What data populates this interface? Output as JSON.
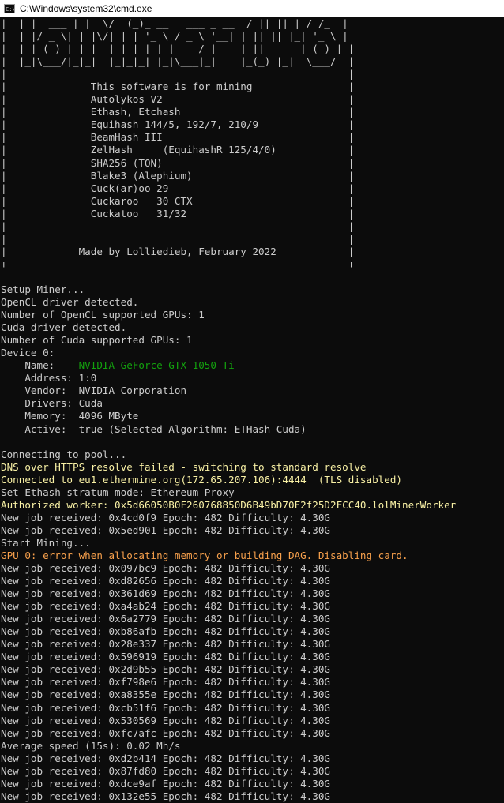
{
  "window": {
    "title": "C:\\Windows\\system32\\cmd.exe",
    "icon": "cmd-icon",
    "icon_glyph": "C:\\"
  },
  "colors": {
    "default": "#cccccc",
    "green": "#13a10e",
    "yellow": "#f9f1a5",
    "orange": "#f7a04c"
  },
  "banner_lines": [
    "|  | |  ___ | |  \\/  (_)_ __   ___ _ __  / || || | / /_  |",
    "|  | |/ _ \\| | |\\/| | | '_ \\ / _ \\ '__| | || || |_| '_ \\ |",
    "|  | | (_) | | |  | | | | | |  __/ |    | ||__   _| (_) | |",
    "|  |_|\\___/|_|_|  |_|_|_| |_|\\___|_|    |_(_) |_|  \\___/  |",
    "|                                                         |",
    "|              This software is for mining                |",
    "|              Autolykos V2                               |",
    "|              Ethash, Etchash                            |",
    "|              Equihash 144/5, 192/7, 210/9               |",
    "|              BeamHash III                               |",
    "|              ZelHash     (EquihashR 125/4/0)            |",
    "|              SHA256 (TON)                               |",
    "|              Blake3 (Alephium)                          |",
    "|              Cuck(ar)oo 29                              |",
    "|              Cuckaroo   30 CTX                          |",
    "|              Cuckatoo   31/32                           |",
    "|                                                         |",
    "|                                                         |",
    "|            Made by Lolliedieb, February 2022            |",
    "+---------------------------------------------------------+",
    ""
  ],
  "log_lines": [
    {
      "text": "Setup Miner...",
      "color": "default"
    },
    {
      "text": "OpenCL driver detected.",
      "color": "default"
    },
    {
      "text": "Number of OpenCL supported GPUs: 1",
      "color": "default"
    },
    {
      "text": "Cuda driver detected.",
      "color": "default"
    },
    {
      "text": "Number of Cuda supported GPUs: 1",
      "color": "default"
    },
    {
      "text": "Device 0:",
      "color": "default"
    },
    {
      "text": "    Name:    ",
      "color": "default",
      "extra": "NVIDIA GeForce GTX 1050 Ti",
      "extra_color": "green"
    },
    {
      "text": "    Address: 1:0",
      "color": "default"
    },
    {
      "text": "    Vendor:  NVIDIA Corporation",
      "color": "default"
    },
    {
      "text": "    Drivers: Cuda",
      "color": "default"
    },
    {
      "text": "    Memory:  4096 MByte",
      "color": "default"
    },
    {
      "text": "    Active:  true (Selected Algorithm: ETHash Cuda)",
      "color": "default"
    },
    {
      "text": "",
      "color": "default"
    },
    {
      "text": "Connecting to pool...",
      "color": "default"
    },
    {
      "text": "DNS over HTTPS resolve failed - switching to standard resolve",
      "color": "yellow"
    },
    {
      "text": "Connected to eu1.ethermine.org(172.65.207.106):4444  (TLS disabled)",
      "color": "yellow"
    },
    {
      "text": "Set Ethash stratum mode: Ethereum Proxy",
      "color": "default"
    },
    {
      "text": "Authorized worker: 0x5d66050B0F260768850D6B49bD70F2f25D2FCC40.lolMinerWorker",
      "color": "yellow"
    },
    {
      "text": "New job received: 0x4cd0f9 Epoch: 482 Difficulty: 4.30G",
      "color": "default"
    },
    {
      "text": "New job received: 0x5ed901 Epoch: 482 Difficulty: 4.30G",
      "color": "default"
    },
    {
      "text": "Start Mining...",
      "color": "default"
    },
    {
      "text": "GPU 0: error when allocating memory or building DAG. Disabling card.",
      "color": "orange"
    },
    {
      "text": "New job received: 0x097bc9 Epoch: 482 Difficulty: 4.30G",
      "color": "default"
    },
    {
      "text": "New job received: 0xd82656 Epoch: 482 Difficulty: 4.30G",
      "color": "default"
    },
    {
      "text": "New job received: 0x361d69 Epoch: 482 Difficulty: 4.30G",
      "color": "default"
    },
    {
      "text": "New job received: 0xa4ab24 Epoch: 482 Difficulty: 4.30G",
      "color": "default"
    },
    {
      "text": "New job received: 0x6a2779 Epoch: 482 Difficulty: 4.30G",
      "color": "default"
    },
    {
      "text": "New job received: 0xb86afb Epoch: 482 Difficulty: 4.30G",
      "color": "default"
    },
    {
      "text": "New job received: 0x28e337 Epoch: 482 Difficulty: 4.30G",
      "color": "default"
    },
    {
      "text": "New job received: 0x596919 Epoch: 482 Difficulty: 4.30G",
      "color": "default"
    },
    {
      "text": "New job received: 0x2d9b55 Epoch: 482 Difficulty: 4.30G",
      "color": "default"
    },
    {
      "text": "New job received: 0xf798e6 Epoch: 482 Difficulty: 4.30G",
      "color": "default"
    },
    {
      "text": "New job received: 0xa8355e Epoch: 482 Difficulty: 4.30G",
      "color": "default"
    },
    {
      "text": "New job received: 0xcb51f6 Epoch: 482 Difficulty: 4.30G",
      "color": "default"
    },
    {
      "text": "New job received: 0x530569 Epoch: 482 Difficulty: 4.30G",
      "color": "default"
    },
    {
      "text": "New job received: 0xfc7afc Epoch: 482 Difficulty: 4.30G",
      "color": "default"
    },
    {
      "text": "Average speed (15s): 0.02 Mh/s",
      "color": "default"
    },
    {
      "text": "New job received: 0xd2b414 Epoch: 482 Difficulty: 4.30G",
      "color": "default"
    },
    {
      "text": "New job received: 0x87fd80 Epoch: 482 Difficulty: 4.30G",
      "color": "default"
    },
    {
      "text": "New job received: 0xdce9af Epoch: 482 Difficulty: 4.30G",
      "color": "default"
    },
    {
      "text": "New job received: 0x132e55 Epoch: 482 Difficulty: 4.30G",
      "color": "default"
    }
  ]
}
